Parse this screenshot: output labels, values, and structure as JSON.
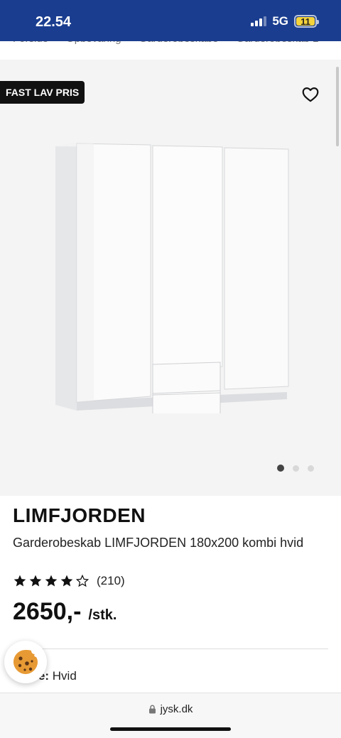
{
  "status": {
    "time": "22.54",
    "network": "5G",
    "battery": "11"
  },
  "breadcrumb": [
    "Forside",
    "Opbevaring",
    "Garderobeskabe",
    "Garderobeskab L"
  ],
  "hero": {
    "badge": "FAST LAV PRIS",
    "icons": {
      "favorite": "heart-outline-icon"
    },
    "carousel": {
      "total": 3,
      "active": 1
    }
  },
  "product": {
    "brand": "LIMFJORDEN",
    "description": "Garderobeskab LIMFJORDEN 180x200 kombi hvid",
    "rating": {
      "value": 4,
      "max": 5,
      "count": "(210)"
    },
    "price": "2650,-",
    "unit": "/stk.",
    "color_label": "Farve:",
    "color_value": "Hvid"
  },
  "browser": {
    "url": "jysk.dk"
  }
}
